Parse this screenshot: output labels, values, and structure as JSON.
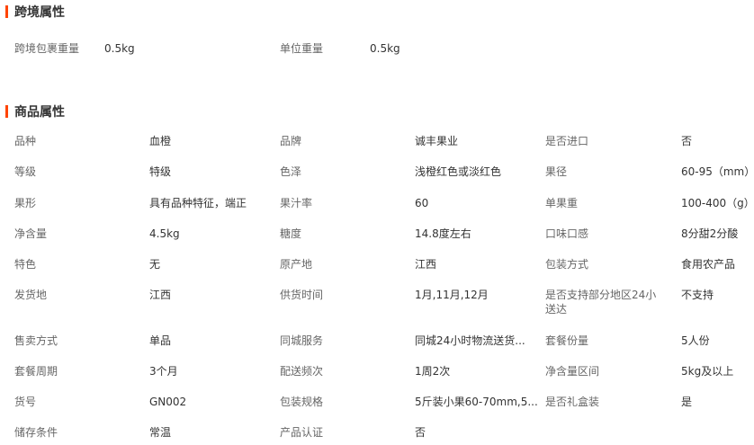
{
  "sections": [
    {
      "title": "跨境属性",
      "rows": [
        [
          [
            "跨境包裹重量",
            "0.5kg"
          ],
          [
            "单位重量",
            "0.5kg"
          ]
        ]
      ]
    },
    {
      "title": "商品属性",
      "rows": [
        [
          [
            "品种",
            "血橙"
          ],
          [
            "品牌",
            "诚丰果业"
          ],
          [
            "是否进口",
            "否"
          ]
        ],
        [
          [
            "等级",
            "特级"
          ],
          [
            "色泽",
            "浅橙红色或淡红色"
          ],
          [
            "果径",
            "60-95（mm）"
          ]
        ],
        [
          [
            "果形",
            "具有品种特征，端正"
          ],
          [
            "果汁率",
            "60"
          ],
          [
            "单果重",
            "100-400（g）"
          ]
        ],
        [
          [
            "净含量",
            "4.5kg"
          ],
          [
            "糖度",
            "14.8度左右"
          ],
          [
            "口味口感",
            "8分甜2分酸"
          ]
        ],
        [
          [
            "特色",
            "无"
          ],
          [
            "原产地",
            "江西"
          ],
          [
            "包装方式",
            "食用农产品"
          ]
        ],
        [
          [
            "发货地",
            "江西"
          ],
          [
            "供货时间",
            "1月,11月,12月"
          ],
          [
            "是否支持部分地区24小送达",
            "不支持"
          ]
        ],
        [
          [
            "售卖方式",
            "单品"
          ],
          [
            "同城服务",
            "同城24小时物流送货..."
          ],
          [
            "套餐份量",
            "5人份"
          ]
        ],
        [
          [
            "套餐周期",
            "3个月"
          ],
          [
            "配送频次",
            "1周2次"
          ],
          [
            "净含量区间",
            "5kg及以上"
          ]
        ],
        [
          [
            "货号",
            "GN002"
          ],
          [
            "包装规格",
            "5斤装小果60-70mm,5..."
          ],
          [
            "是否礼盒装",
            "是"
          ]
        ],
        [
          [
            "储存条件",
            "常温"
          ],
          [
            "产品认证",
            "否"
          ]
        ]
      ]
    }
  ]
}
